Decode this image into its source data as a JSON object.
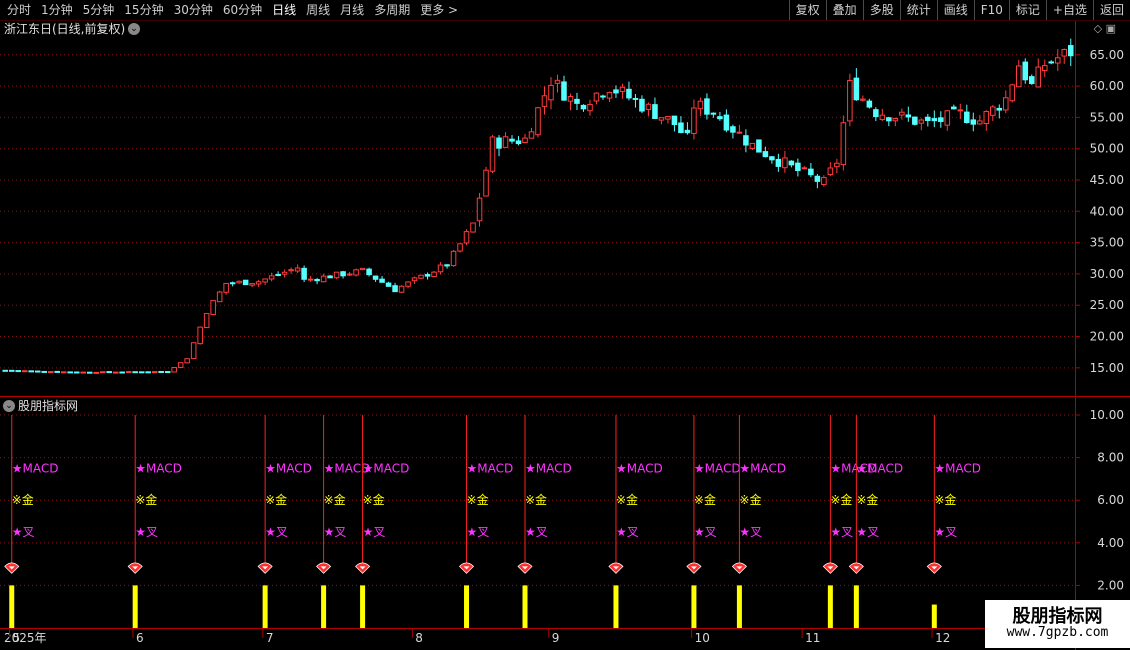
{
  "toolbar": {
    "left_items": [
      "分时",
      "1分钟",
      "5分钟",
      "15分钟",
      "30分钟",
      "60分钟",
      "日线",
      "周线",
      "月线",
      "多周期",
      "更多 >"
    ],
    "active": "日线",
    "right_items": [
      "复权",
      "叠加",
      "多股",
      "统计",
      "画线",
      "F10",
      "标记",
      "+自选",
      "返回"
    ]
  },
  "stock_title": "浙江东日(日线,前复权)",
  "indicator_title": "股朋指标网",
  "watermark": {
    "title": "股朋指标网",
    "url": "www.7gpzb.com"
  },
  "colors": {
    "up": "#ff3b3b",
    "down": "#54ffff",
    "grid": "#8a1010",
    "magenta": "#ff33ff",
    "yellow": "#ffff00"
  },
  "chart_data": [
    {
      "type": "candlestick",
      "title": "浙江东日(日线,前复权)",
      "ylim": [
        10.5,
        68
      ],
      "y_ticks": [
        "15.00",
        "20.00",
        "25.00",
        "30.00",
        "35.00",
        "40.00",
        "45.00",
        "50.00",
        "55.00",
        "60.00",
        "65.00"
      ],
      "x_axis": {
        "labels": [
          "2025年",
          "5",
          "6",
          "7",
          "8",
          "9",
          "10",
          "11",
          "12"
        ],
        "label_dates": [
          "2025-04-30",
          "2025-05-06",
          "2025-06-03",
          "2025-07-01",
          "2025-08-01",
          "2025-09-01",
          "2025-10-09",
          "2025-11-03",
          "2025-12-01"
        ]
      },
      "ohlc_anchors": [
        [
          "2025-04-30",
          14.6
        ],
        [
          "2025-05-20",
          14.3
        ],
        [
          "2025-06-10",
          14.4
        ],
        [
          "2025-06-13",
          16.5
        ],
        [
          "2025-06-18",
          24.0
        ],
        [
          "2025-06-23",
          28.5
        ],
        [
          "2025-06-30",
          28.8
        ],
        [
          "2025-07-08",
          31.0
        ],
        [
          "2025-07-09",
          29.0
        ],
        [
          "2025-07-22",
          30.5
        ],
        [
          "2025-07-29",
          27.5
        ],
        [
          "2025-08-08",
          31.5
        ],
        [
          "2025-08-14",
          38.0
        ],
        [
          "2025-08-19",
          51.0
        ],
        [
          "2025-08-26",
          51.5
        ],
        [
          "2025-09-01",
          61.0
        ],
        [
          "2025-09-05",
          57.0
        ],
        [
          "2025-09-12",
          60.0
        ],
        [
          "2025-09-19",
          57.0
        ],
        [
          "2025-09-26",
          54.0
        ],
        [
          "2025-09-30",
          51.5
        ],
        [
          "2025-10-09",
          57.0
        ],
        [
          "2025-10-14",
          56.0
        ],
        [
          "2025-10-22",
          50.5
        ],
        [
          "2025-10-30",
          47.0
        ],
        [
          "2025-11-06",
          44.5
        ],
        [
          "2025-11-10",
          48.0
        ],
        [
          "2025-11-12",
          60.0
        ],
        [
          "2025-11-18",
          56.0
        ],
        [
          "2025-11-28",
          54.0
        ],
        [
          "2025-12-05",
          55.5
        ],
        [
          "2025-12-10",
          54.5
        ],
        [
          "2025-12-16",
          58.0
        ],
        [
          "2025-12-18",
          63.5
        ],
        [
          "2025-12-22",
          60.0
        ],
        [
          "2025-12-24",
          63.5
        ],
        [
          "2025-12-30",
          65.5
        ]
      ]
    },
    {
      "type": "signal",
      "title": "股朋指标网",
      "ylim": [
        0,
        10.8
      ],
      "y_ticks": [
        "2.00",
        "4.00",
        "6.00",
        "8.00",
        "10.00"
      ],
      "signal_labels": {
        "macd": "★MACD",
        "gold": "※金",
        "cross": "★叉"
      },
      "levels": {
        "line_top": 10,
        "macd": 7.5,
        "gold": 6.0,
        "cross": 4.5,
        "marker": 2.8,
        "bar_top": 2.0,
        "bar_top_last": 1.1
      },
      "signal_dates": [
        "2025-05-06",
        "2025-06-03",
        "2025-07-01",
        "2025-07-14",
        "2025-07-22",
        "2025-08-13",
        "2025-08-26",
        "2025-09-15",
        "2025-10-09",
        "2025-10-20",
        "2025-11-07",
        "2025-11-13",
        "2025-12-01"
      ]
    }
  ]
}
